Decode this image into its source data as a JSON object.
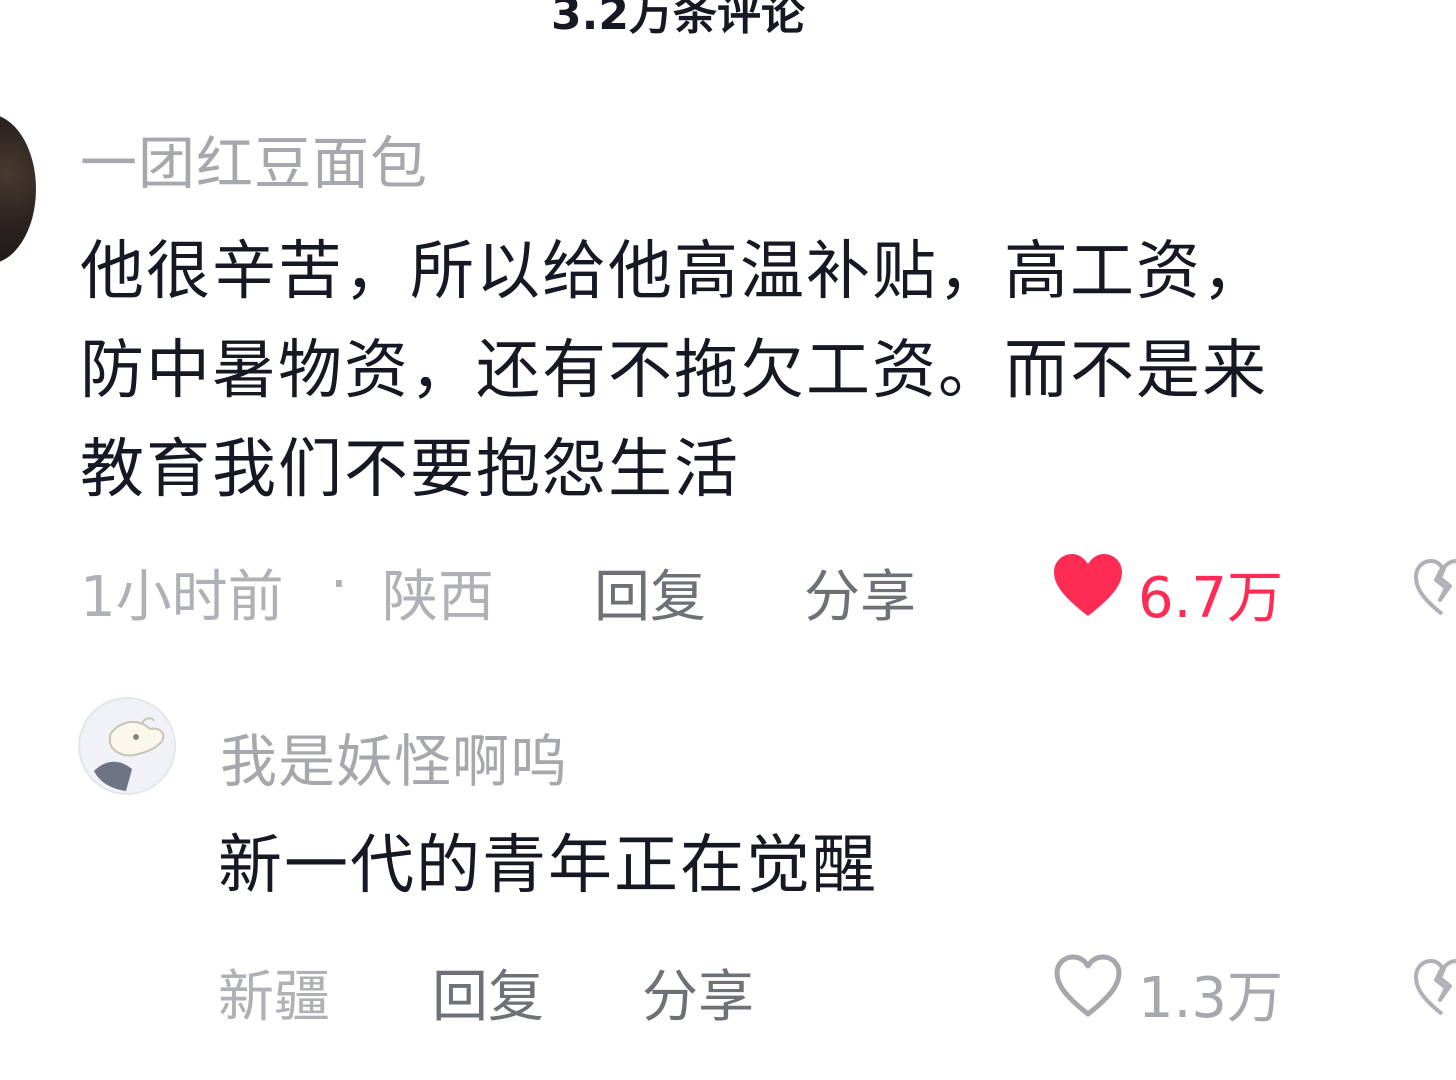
{
  "header": {
    "comment_count": "3.2万条评论"
  },
  "comments": [
    {
      "username": "一团红豆面包",
      "text_lines": [
        "他很辛苦，所以给他高温补贴，高工资，",
        "防中暑物资，还有不拖欠工资。而不是来",
        "教育我们不要抱怨生活"
      ],
      "time": "1小时前",
      "separator": "·",
      "location": "陕西",
      "reply_label": "回复",
      "share_label": "分享",
      "likes": "6.7万",
      "liked": true,
      "like_color": "#fe2c55"
    },
    {
      "username": "我是妖怪啊呜",
      "text": "新一代的青年正在觉醒",
      "location": "新疆",
      "reply_label": "回复",
      "share_label": "分享",
      "likes": "1.3万",
      "liked": false
    }
  ],
  "icons": {
    "like_filled": "heart-filled-icon",
    "like_outline": "heart-outline-icon",
    "dislike": "broken-heart-icon"
  }
}
